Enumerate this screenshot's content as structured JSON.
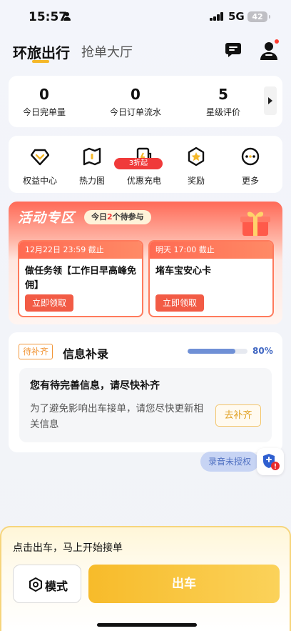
{
  "status_bar": {
    "time": "15:57",
    "network": "5G",
    "battery": "42"
  },
  "header": {
    "tab_active": "环旅出行",
    "tab_inactive": "抢单大厅"
  },
  "stats": [
    {
      "value": "0",
      "label": "今日完单量"
    },
    {
      "value": "0",
      "label": "今日订单流水"
    },
    {
      "value": "5",
      "label": "星级评价"
    }
  ],
  "functions": [
    {
      "label": "权益中心",
      "icon": "diamond-icon"
    },
    {
      "label": "热力图",
      "icon": "map-icon"
    },
    {
      "label": "优惠充电",
      "icon": "charge-icon",
      "badge": "3折起"
    },
    {
      "label": "奖励",
      "icon": "star-badge-icon"
    },
    {
      "label": "更多",
      "icon": "more-icon"
    }
  ],
  "activity": {
    "title": "活动专区",
    "pill_prefix": "今日",
    "pill_count": "2",
    "pill_suffix": "个待参与",
    "cards": [
      {
        "deadline": "12月22日 23:59 截止",
        "title": "做任务领【工作日早高峰免佣】",
        "button": "立即领取"
      },
      {
        "deadline": "明天 17:00 截止",
        "title": "堵车宝安心卡",
        "button": "立即领取"
      }
    ]
  },
  "info": {
    "tag": "待补齐",
    "title": "信息补录",
    "progress": 0.8,
    "progress_text": "80%",
    "head": "您有待完善信息，请尽快补齐",
    "body": "为了避免影响出车接单，请您尽快更新相关信息",
    "button": "去补齐"
  },
  "floating": {
    "record_chip": "录音未授权"
  },
  "bottom": {
    "hint": "点击出车，马上开始接单",
    "mode_label": "模式",
    "go_label": "出车"
  },
  "colors": {
    "accent": "#F7BB2A",
    "activity": "#FF6A57",
    "progress": "#6F90D6",
    "badge": "#F03A3A"
  }
}
